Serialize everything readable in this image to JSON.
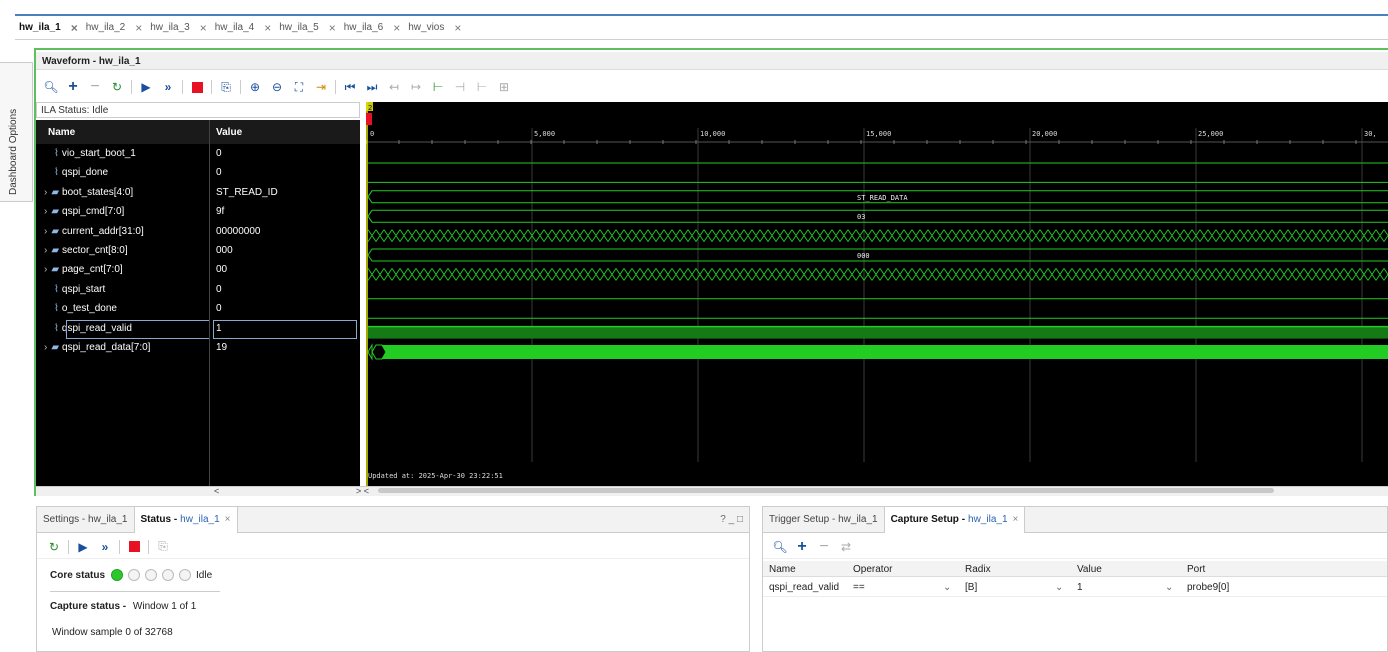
{
  "tabs": [
    {
      "label": "hw_ila_1",
      "active": true
    },
    {
      "label": "hw_ila_2"
    },
    {
      "label": "hw_ila_3"
    },
    {
      "label": "hw_ila_4"
    },
    {
      "label": "hw_ila_5"
    },
    {
      "label": "hw_ila_6"
    },
    {
      "label": "hw_vios"
    }
  ],
  "sidebar_label": "Dashboard Options",
  "waveform": {
    "title": "Waveform - hw_ila_1",
    "ila_status": "ILA Status: Idle",
    "col_name": "Name",
    "col_value": "Value",
    "signals": [
      {
        "name": "vio_start_boot_1",
        "value": "0",
        "bus": false
      },
      {
        "name": "qspi_done",
        "value": "0",
        "bus": false
      },
      {
        "name": "boot_states[4:0]",
        "value": "ST_READ_ID",
        "bus": true
      },
      {
        "name": "qspi_cmd[7:0]",
        "value": "9f",
        "bus": true
      },
      {
        "name": "current_addr[31:0]",
        "value": "00000000",
        "bus": true
      },
      {
        "name": "sector_cnt[8:0]",
        "value": "000",
        "bus": true
      },
      {
        "name": "page_cnt[7:0]",
        "value": "00",
        "bus": true
      },
      {
        "name": "qspi_start",
        "value": "0",
        "bus": false
      },
      {
        "name": "o_test_done",
        "value": "0",
        "bus": false
      },
      {
        "name": "qspi_read_valid",
        "value": "1",
        "bus": false,
        "selected": true
      },
      {
        "name": "qspi_read_data[7:0]",
        "value": "19",
        "bus": true
      }
    ],
    "timeline_labels": [
      "0",
      "5,000",
      "10,000",
      "15,000",
      "20,000",
      "25,000",
      "30,"
    ],
    "marker_label": "2",
    "bus_labels": {
      "boot_states": "ST_READ_DATA",
      "qspi_cmd": "03",
      "sector_cnt": "000"
    },
    "updated": "Updated at: 2025-Apr-30 23:22:51",
    "scroll_left": "<",
    "scroll_right": "> <"
  },
  "status_panel": {
    "tab_settings": "Settings - hw_ila_1",
    "tab_status": "Status -",
    "tab_status_link": "hw_ila_1",
    "win_controls": "? _ □",
    "core_status_label": "Core status",
    "core_status_value": "Idle",
    "capture_status_label": "Capture status -",
    "capture_status_value": "Window 1 of 1",
    "window_sample": "Window sample 0 of 32768"
  },
  "trigger_panel": {
    "tab_trigger": "Trigger Setup - hw_ila_1",
    "tab_capture": "Capture Setup -",
    "tab_capture_link": "hw_ila_1",
    "columns": [
      "Name",
      "Operator",
      "Radix",
      "Value",
      "Port"
    ],
    "row": {
      "name": "qspi_read_valid",
      "operator": "==",
      "radix": "[B]",
      "value": "1",
      "port": "probe9[0]"
    }
  },
  "colors": {
    "green": "#22cc22",
    "wave_bg": "#000000",
    "accent": "#4a7fc0",
    "stop_red": "#e81123"
  }
}
